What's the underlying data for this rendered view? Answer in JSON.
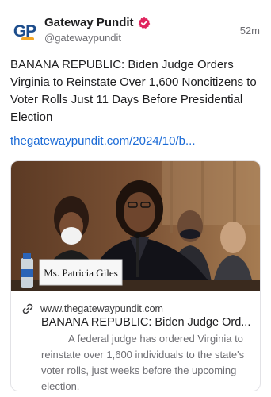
{
  "post": {
    "account_name": "Gateway Pundit",
    "handle": "@gatewaypundit",
    "timestamp": "52m",
    "avatar_text": "GP",
    "body": "BANANA REPUBLIC: Biden Judge Orders Virginia to Reinstate Over 1,600 Noncitizens to Voter Rolls Just 11 Days Before Presidential Election",
    "link_text": "thegatewaypundit.com/2024/10/b..."
  },
  "link_card": {
    "image_nameplate": "Ms. Patricia Giles",
    "domain": "www.thegatewaypundit.com",
    "title": "BANANA REPUBLIC: Biden Judge Ord...",
    "description": "A federal judge has ordered Virginia to reinstate over 1,600 individuals to the state's voter rolls, just weeks before the upcoming election."
  },
  "icons": {
    "verified": "verified-badge-icon",
    "link": "link-chain-icon"
  },
  "colors": {
    "verified_badge": "#e0245e",
    "link": "#1a6ad6",
    "avatar_text": "#1d4d8c",
    "avatar_accent": "#f5a623"
  }
}
